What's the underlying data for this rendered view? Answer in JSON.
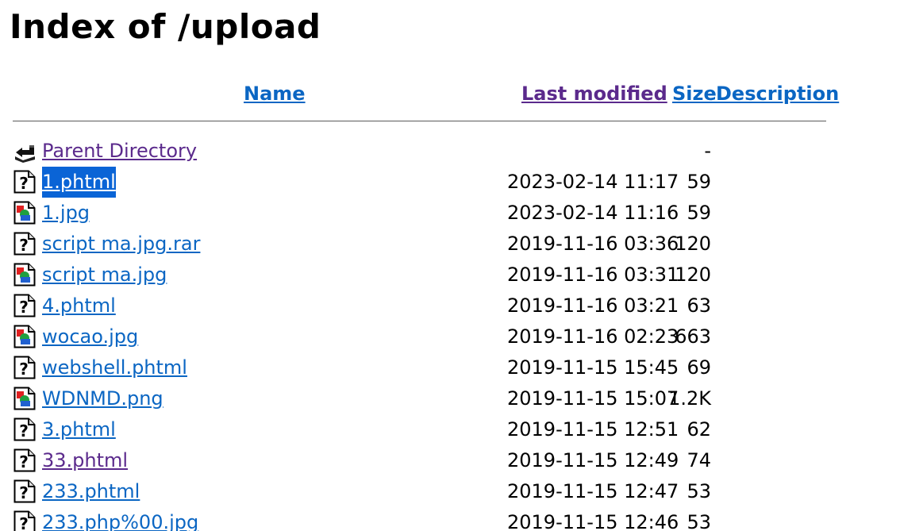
{
  "page": {
    "title": "Index of /upload"
  },
  "columns": {
    "name": "Name",
    "last_modified": "Last modified",
    "size": "Size",
    "description": "Description"
  },
  "colors": {
    "link": "#0b66c3",
    "visited_link": "#5b2a8c",
    "selection": "#0a64d6"
  },
  "parent": {
    "label": "Parent Directory",
    "size": "-",
    "icon": "back-arrow-icon"
  },
  "rows": [
    {
      "name": "1.phtml",
      "date": "2023-02-14 11:17",
      "size": "59",
      "icon": "unknown-file-icon",
      "selected": true
    },
    {
      "name": "1.jpg",
      "date": "2023-02-14 11:16",
      "size": "59",
      "icon": "image-file-icon"
    },
    {
      "name": "script ma.jpg.rar",
      "date": "2019-11-16 03:36",
      "size": "120",
      "icon": "unknown-file-icon"
    },
    {
      "name": "script ma.jpg",
      "date": "2019-11-16 03:31",
      "size": "120",
      "icon": "image-file-icon"
    },
    {
      "name": "4.phtml",
      "date": "2019-11-16 03:21",
      "size": "63",
      "icon": "unknown-file-icon"
    },
    {
      "name": "wocao.jpg",
      "date": "2019-11-16 02:23",
      "size": "663",
      "icon": "image-file-icon"
    },
    {
      "name": "webshell.phtml",
      "date": "2019-11-15 15:45",
      "size": "69",
      "icon": "unknown-file-icon"
    },
    {
      "name": "WDNMD.png",
      "date": "2019-11-15 15:07",
      "size": "1.2K",
      "icon": "image-file-icon"
    },
    {
      "name": "3.phtml",
      "date": "2019-11-15 12:51",
      "size": "62",
      "icon": "unknown-file-icon"
    },
    {
      "name": "33.phtml",
      "date": "2019-11-15 12:49",
      "size": "74",
      "icon": "unknown-file-icon",
      "visited": true
    },
    {
      "name": "233.phtml",
      "date": "2019-11-15 12:47",
      "size": "53",
      "icon": "unknown-file-icon"
    },
    {
      "name": "233.php%00.jpg",
      "date": "2019-11-15 12:46",
      "size": "53",
      "icon": "unknown-file-icon"
    }
  ]
}
